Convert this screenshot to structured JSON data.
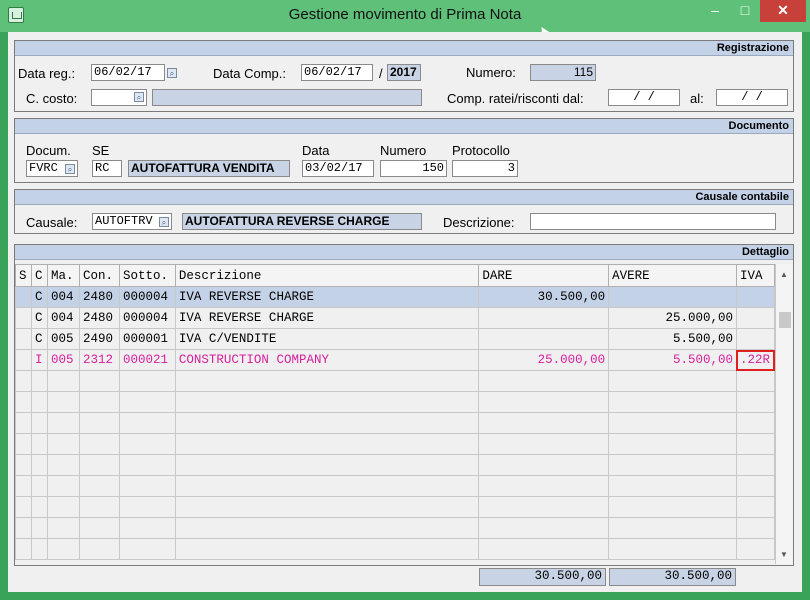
{
  "window": {
    "title": "Gestione movimento di Prima Nota",
    "minimize": "–",
    "maximize": "□",
    "close": "✕"
  },
  "registrazione": {
    "header": "Registrazione",
    "data_reg_label": "Data reg.:",
    "data_reg": "06/02/17",
    "data_comp_label": "Data Comp.:",
    "data_comp": "06/02/17",
    "slash": "/",
    "year": "2017",
    "numero_label": "Numero:",
    "numero": "115",
    "c_costo_label": "C. costo:",
    "c_costo": "",
    "c_costo_desc": "",
    "comp_label": "Comp. ratei/risconti dal:",
    "comp_dal": "/   /",
    "al_label": "al:",
    "comp_al": "/   /"
  },
  "documento": {
    "header": "Documento",
    "docum_label": "Docum.",
    "docum": "FVRC",
    "se_label": "SE",
    "se": "RC",
    "se_desc": "AUTOFATTURA VENDITA",
    "data_label": "Data",
    "data": "03/02/17",
    "numero_label": "Numero",
    "numero": "150",
    "protocollo_label": "Protocollo",
    "protocollo": "3"
  },
  "causale": {
    "header": "Causale contabile",
    "causale_label": "Causale:",
    "causale": "AUTOFTRV",
    "causale_desc": "AUTOFATTURA REVERSE CHARGE",
    "descrizione_label": "Descrizione:",
    "descrizione": ""
  },
  "dettaglio": {
    "header": "Dettaglio",
    "columns": [
      "S",
      "C",
      "Ma.",
      "Con.",
      "Sotto.",
      "Descrizione",
      "DARE",
      "AVERE",
      "IVA"
    ],
    "rows": [
      {
        "s": "",
        "c": "C",
        "ma": "004",
        "con": "2480",
        "sotto": "000004",
        "desc": "IVA REVERSE CHARGE",
        "dare": "30.500,00",
        "avere": "",
        "iva": ""
      },
      {
        "s": "",
        "c": "C",
        "ma": "004",
        "con": "2480",
        "sotto": "000004",
        "desc": "IVA REVERSE CHARGE",
        "dare": "",
        "avere": "25.000,00",
        "iva": ""
      },
      {
        "s": "",
        "c": "C",
        "ma": "005",
        "con": "2490",
        "sotto": "000001",
        "desc": "IVA C/VENDITE",
        "dare": "",
        "avere": "5.500,00",
        "iva": ""
      },
      {
        "s": "",
        "c": "I",
        "ma": "005",
        "con": "2312",
        "sotto": "000021",
        "desc": "CONSTRUCTION COMPANY",
        "dare": "25.000,00",
        "avere": "5.500,00",
        "iva": ".22R"
      }
    ],
    "empty_rows": 9,
    "total_dare": "30.500,00",
    "total_avere": "30.500,00"
  },
  "colors": {
    "titlebar": "#5fc07a",
    "panel_header": "#c4d2e8",
    "highlight_text": "#d6209c",
    "close": "#c7403a"
  }
}
